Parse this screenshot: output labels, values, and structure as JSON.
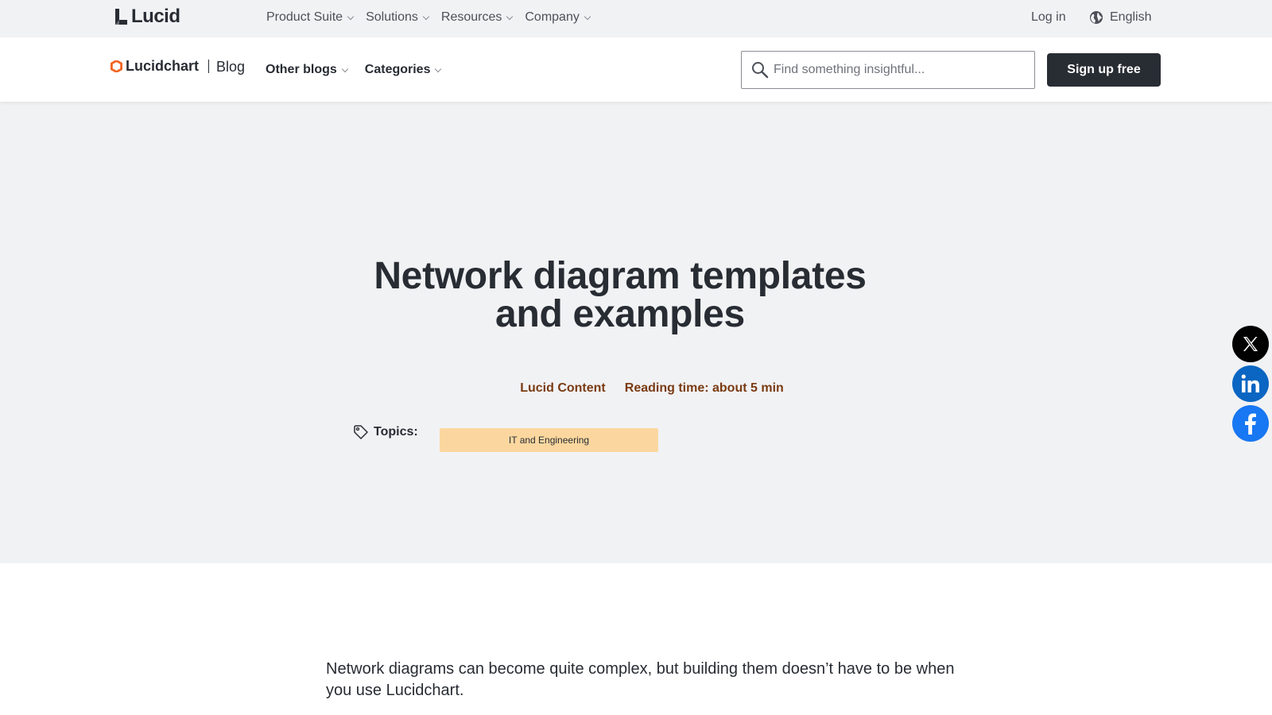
{
  "global_nav": {
    "logo_text": "Lucid",
    "items": [
      {
        "label": "Product Suite"
      },
      {
        "label": "Solutions"
      },
      {
        "label": "Resources"
      },
      {
        "label": "Company"
      }
    ],
    "login_label": "Log in",
    "language_label": "English"
  },
  "blog_header": {
    "logo_text": "Lucidchart",
    "blog_label": "Blog",
    "nav": [
      {
        "label": "Other blogs"
      },
      {
        "label": "Categories"
      }
    ],
    "search_placeholder": "Find something insightful...",
    "signup_label": "Sign up free"
  },
  "hero": {
    "title_line1": "Network diagram templates",
    "title_line2": "and examples",
    "author": "Lucid Content",
    "reading_time": "Reading time: about 5 min",
    "topics_label": "Topics:",
    "topic_tag": "IT and Engineering"
  },
  "share": {
    "x_icon": "x-icon",
    "linkedin_icon": "linkedin-icon",
    "facebook_icon": "facebook-icon"
  },
  "article": {
    "intro": "Network diagrams can become quite complex, but building them doesn’t have to be when you use Lucidchart."
  },
  "colors": {
    "dark": "#282c33",
    "hero_bg": "#f1f2f4",
    "meta_text": "#7a3b12",
    "tag_bg": "#fbd79f",
    "brand_orange": "#f26522"
  }
}
